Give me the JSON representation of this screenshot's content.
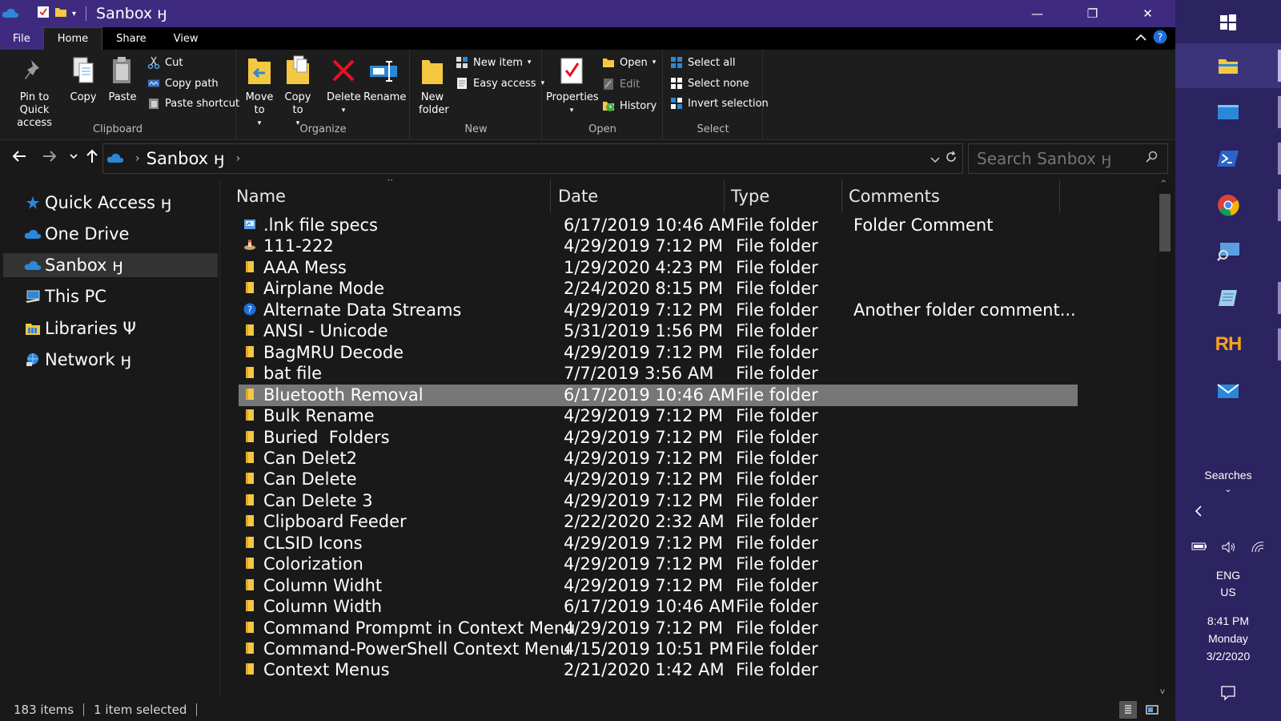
{
  "window": {
    "title": "Sanbox ӈ",
    "minimize": "—",
    "maximize": "❐",
    "close": "✕"
  },
  "ribbon_tabs": [
    "File",
    "Home",
    "Share",
    "View"
  ],
  "ribbon": {
    "clipboard": {
      "label": "Clipboard",
      "pin": "Pin to Quick access",
      "copy": "Copy",
      "paste": "Paste",
      "cut": "Cut",
      "copy_path": "Copy path",
      "paste_shortcut": "Paste shortcut"
    },
    "organize": {
      "label": "Organize",
      "move_to": "Move to",
      "copy_to": "Copy to",
      "delete": "Delete",
      "rename": "Rename"
    },
    "new": {
      "label": "New",
      "new_folder": "New folder",
      "new_item": "New item",
      "easy_access": "Easy access"
    },
    "open": {
      "label": "Open",
      "properties": "Properties",
      "open": "Open",
      "edit": "Edit",
      "history": "History"
    },
    "select": {
      "label": "Select",
      "select_all": "Select all",
      "select_none": "Select none",
      "invert": "Invert selection"
    }
  },
  "address": {
    "path": "Sanbox ӈ",
    "search_placeholder": "Search Sanbox ӈ"
  },
  "nav_pane": [
    {
      "label": "Quick Access ӈ",
      "icon": "star-icon"
    },
    {
      "label": "One Drive",
      "icon": "cloud-icon"
    },
    {
      "label": "Sanbox ӈ",
      "icon": "cloud-icon",
      "selected": true
    },
    {
      "label": "This PC",
      "icon": "computer-icon"
    },
    {
      "label": "Libraries Ψ",
      "icon": "library-icon"
    },
    {
      "label": "Network ӈ",
      "icon": "network-icon"
    }
  ],
  "columns": [
    "Name",
    "Date",
    "Type",
    "Comments"
  ],
  "files": [
    {
      "name": ".lnk file specs",
      "date": "6/17/2019 10:46 AM",
      "type": "File folder",
      "comment": "Folder Comment",
      "icon": "shortcut-folder-icon"
    },
    {
      "name": "111-222",
      "date": "4/29/2019 7:12 PM",
      "type": "File folder",
      "comment": "",
      "icon": "custom-folder-icon"
    },
    {
      "name": "AAA Mess",
      "date": "1/29/2020 4:23 PM",
      "type": "File folder",
      "comment": "",
      "icon": "folder-icon"
    },
    {
      "name": "Airplane Mode",
      "date": "2/24/2020 8:15 PM",
      "type": "File folder",
      "comment": "",
      "icon": "folder-icon"
    },
    {
      "name": "Alternate Data Streams",
      "date": "4/29/2019 7:12 PM",
      "type": "File folder",
      "comment": "Another folder comment...",
      "icon": "help-icon"
    },
    {
      "name": "ANSI - Unicode",
      "date": "5/31/2019 1:56 PM",
      "type": "File folder",
      "comment": "",
      "icon": "folder-icon"
    },
    {
      "name": "BagMRU Decode",
      "date": "4/29/2019 7:12 PM",
      "type": "File folder",
      "comment": "",
      "icon": "folder-icon"
    },
    {
      "name": "bat file",
      "date": "7/7/2019 3:56 AM",
      "type": "File folder",
      "comment": "",
      "icon": "folder-icon"
    },
    {
      "name": "Bluetooth Removal",
      "date": "6/17/2019 10:46 AM",
      "type": "File folder",
      "comment": "",
      "icon": "folder-icon",
      "selected": true
    },
    {
      "name": "Bulk Rename",
      "date": "4/29/2019 7:12 PM",
      "type": "File folder",
      "comment": "",
      "icon": "folder-icon"
    },
    {
      "name": "Buried  Folders",
      "date": "4/29/2019 7:12 PM",
      "type": "File folder",
      "comment": "",
      "icon": "folder-icon"
    },
    {
      "name": "Can Delet2",
      "date": "4/29/2019 7:12 PM",
      "type": "File folder",
      "comment": "",
      "icon": "folder-icon"
    },
    {
      "name": "Can Delete",
      "date": "4/29/2019 7:12 PM",
      "type": "File folder",
      "comment": "",
      "icon": "folder-icon"
    },
    {
      "name": "Can Delete 3",
      "date": "4/29/2019 7:12 PM",
      "type": "File folder",
      "comment": "",
      "icon": "folder-icon"
    },
    {
      "name": "Clipboard Feeder",
      "date": "2/22/2020 2:32 AM",
      "type": "File folder",
      "comment": "",
      "icon": "folder-icon"
    },
    {
      "name": "CLSID Icons",
      "date": "4/29/2019 7:12 PM",
      "type": "File folder",
      "comment": "",
      "icon": "folder-icon"
    },
    {
      "name": "Colorization",
      "date": "4/29/2019 7:12 PM",
      "type": "File folder",
      "comment": "",
      "icon": "folder-icon"
    },
    {
      "name": "Column Widht",
      "date": "4/29/2019 7:12 PM",
      "type": "File folder",
      "comment": "",
      "icon": "folder-icon"
    },
    {
      "name": "Column Width",
      "date": "6/17/2019 10:46 AM",
      "type": "File folder",
      "comment": "",
      "icon": "folder-icon"
    },
    {
      "name": "Command Prompmt in Context Menu",
      "date": "4/29/2019 7:12 PM",
      "type": "File folder",
      "comment": "",
      "icon": "folder-icon"
    },
    {
      "name": "Command-PowerShell Context Menu",
      "date": "4/15/2019 10:51 PM",
      "type": "File folder",
      "comment": "",
      "icon": "folder-icon"
    },
    {
      "name": "Context Menus",
      "date": "2/21/2020 1:42 AM",
      "type": "File folder",
      "comment": "",
      "icon": "folder-icon"
    }
  ],
  "status": {
    "count": "183 items",
    "selected": "1 item selected"
  },
  "taskbar": {
    "searches": "Searches",
    "lang1": "ENG",
    "lang2": "US",
    "time": "8:41 PM",
    "day": "Monday",
    "date": "3/2/2020",
    "rh": "RH"
  },
  "colors": {
    "title": "#3e2b80",
    "taskbar": "#2c2361",
    "folder": "#f4c842",
    "accent": "#2b88d8"
  }
}
